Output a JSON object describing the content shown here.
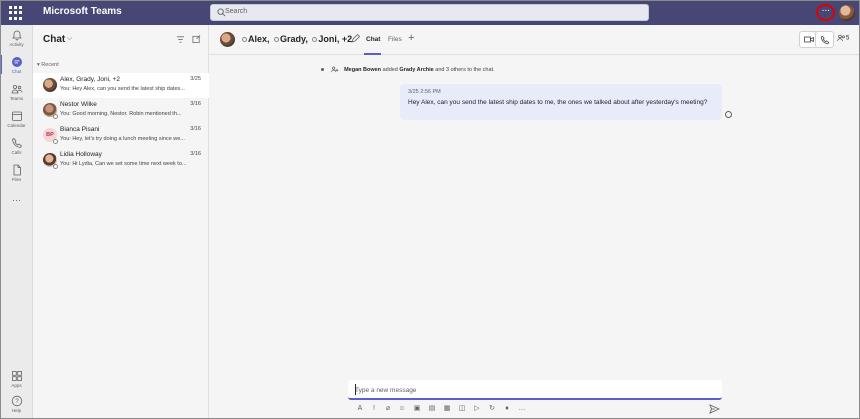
{
  "app": {
    "title": "Microsoft Teams",
    "search_placeholder": "Search",
    "more_label": "···",
    "colors": {
      "topbar": "#464775",
      "accent": "#5b5fc7",
      "highlight": "#e00000"
    }
  },
  "rail": {
    "items": [
      {
        "label": "Activity",
        "icon": "bell-icon"
      },
      {
        "label": "Chat",
        "icon": "chat-icon"
      },
      {
        "label": "Teams",
        "icon": "teams-icon"
      },
      {
        "label": "Calendar",
        "icon": "calendar-icon"
      },
      {
        "label": "Calls",
        "icon": "phone-icon"
      },
      {
        "label": "Files",
        "icon": "file-icon"
      },
      {
        "label": "···",
        "icon": "more-icon"
      },
      {
        "label": "Apps",
        "icon": "apps-icon"
      },
      {
        "label": "Help",
        "icon": "help-icon"
      }
    ]
  },
  "chat_list": {
    "title": "Chat",
    "section_label": "Recent",
    "items": [
      {
        "name": "Alex, Grady, Joni, +2",
        "date": "3/25",
        "preview": "You: Hey Alex, can you send the latest ship dates...",
        "avatar_initials": ""
      },
      {
        "name": "Nestor Wilke",
        "date": "3/16",
        "preview": "You: Good morning, Nestor. Robin mentioned th...",
        "avatar_initials": ""
      },
      {
        "name": "Bianca Pisani",
        "date": "3/16",
        "preview": "You: Hey, let's try doing a lunch meeting since we...",
        "avatar_initials": "BP"
      },
      {
        "name": "Lidia Holloway",
        "date": "3/16",
        "preview": "You: Hi Lydia, Can we set some time next week to...",
        "avatar_initials": ""
      }
    ]
  },
  "conversation": {
    "header_names": [
      "Alex,",
      "Grady,",
      "Joni, +2"
    ],
    "tabs": [
      "Chat",
      "Files"
    ],
    "add_tab": "+",
    "people_count": "5",
    "system_message": {
      "actor": "Megan Bowen",
      "middle": " added ",
      "target": "Grady Archie",
      "rest": " and 3 others to the chat."
    },
    "message": {
      "time": "3/25 2:56 PM",
      "text": "Hey Alex, can you send the latest ship dates to me, the ones we talked about after yesterday's meeting?"
    },
    "composer_placeholder": "Type a new message"
  }
}
